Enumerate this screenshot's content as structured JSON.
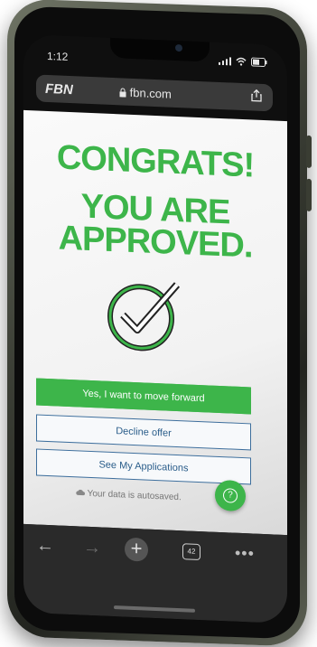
{
  "status_bar": {
    "time": "1:12"
  },
  "browser": {
    "logo": "FBN",
    "url": "fbn.com"
  },
  "page": {
    "headline": "CONGRATS!",
    "subheadline": "YOU ARE\nAPPROVED.",
    "primary_button": "Yes, I want to move forward",
    "decline_button": "Decline offer",
    "applications_button": "See My Applications",
    "autosave_text": "Your data is autosaved.",
    "help_icon": "?"
  },
  "toolbar": {
    "tab_count": "42",
    "back_icon": "←",
    "forward_icon": "→",
    "new_tab_icon": "+",
    "more_icon": "•••"
  },
  "colors": {
    "accent_green": "#3db54a",
    "link_blue": "#2a5d8a"
  }
}
